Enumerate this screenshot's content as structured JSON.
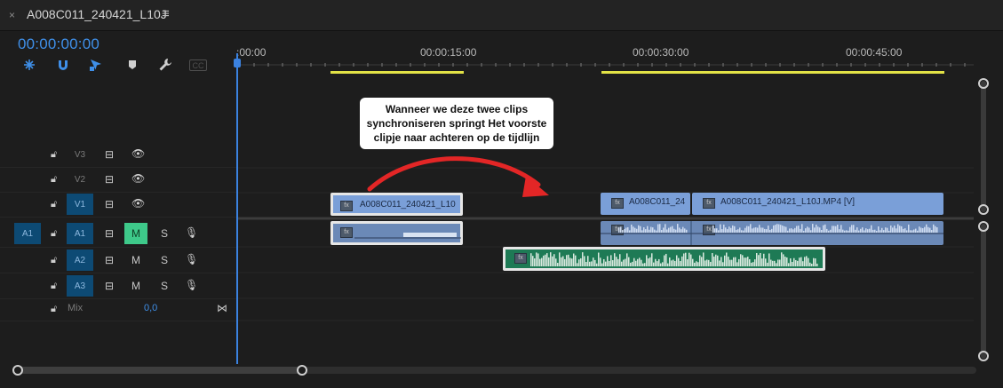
{
  "tab": {
    "close": "×",
    "title": "A008C011_240421_L10J",
    "menu": "≡"
  },
  "timecode": "00:00:00:00",
  "toolbar": {
    "tools": [
      {
        "name": "snap-nested-icon"
      },
      {
        "name": "magnet-snap-icon"
      },
      {
        "name": "linked-selection-icon"
      },
      {
        "name": "marker-icon"
      },
      {
        "name": "wrench-settings-icon"
      },
      {
        "name": "captions-icon",
        "label": "CC"
      }
    ]
  },
  "ruler": {
    "labels": [
      ":00:00",
      "00:00:15:00",
      "00:00:30:00",
      "00:00:45:00"
    ]
  },
  "tracks": {
    "v3": {
      "name": "V3"
    },
    "v2": {
      "name": "V2"
    },
    "v1": {
      "name": "V1"
    },
    "a1": {
      "source": "A1",
      "name": "A1",
      "m": "M",
      "s": "S"
    },
    "a2": {
      "name": "A2",
      "m": "M",
      "s": "S"
    },
    "a3": {
      "name": "A3",
      "m": "M",
      "s": "S"
    },
    "mix": {
      "name": "Mix",
      "value": "0,0"
    }
  },
  "clips": {
    "v1_first": {
      "name": "A008C011_240421_L10"
    },
    "v1_second": {
      "name": "A008C011_24"
    },
    "v1_third": {
      "name": "A008C011_240421_L10J.MP4 [V]"
    },
    "fx": "fx"
  },
  "callout": {
    "lines": [
      "Wanneer we deze twee clips",
      "synchroniseren springt Het voorste",
      "clipje naar achteren op de tijdlijn"
    ]
  },
  "colors": {
    "accent_blue": "#3f8fe8",
    "video_clip": "#7a9fd8",
    "audio_clip": "#6b89b7",
    "green_clip": "#1e7a55",
    "arrow_red": "#e32626",
    "work_area": "#e2e246"
  }
}
